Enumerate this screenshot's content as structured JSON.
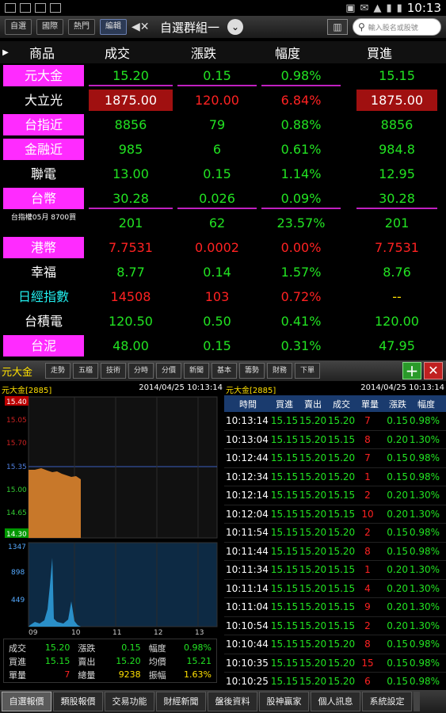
{
  "status": {
    "time": "10:13"
  },
  "toolbar": {
    "buttons": [
      "自選",
      "國際",
      "熱門",
      "編輯"
    ],
    "group_title": "自選群組一",
    "search_placeholder": "輸入股名或股號"
  },
  "quote_headers": [
    "商品",
    "成交",
    "漲跌",
    "幅度",
    "買進"
  ],
  "quotes": [
    {
      "name": "元大金",
      "price": "15.20",
      "change": "0.15",
      "pct": "0.98%",
      "bid": "15.15"
    },
    {
      "name": "大立光",
      "price": "1875.00",
      "change": "120.00",
      "pct": "6.84%",
      "bid": "1875.00"
    },
    {
      "name": "台指近",
      "price": "8856",
      "change": "79",
      "pct": "0.88%",
      "bid": "8856"
    },
    {
      "name": "金融近",
      "price": "985",
      "change": "6",
      "pct": "0.61%",
      "bid": "984.8"
    },
    {
      "name": "聯電",
      "price": "13.00",
      "change": "0.15",
      "pct": "1.14%",
      "bid": "12.95"
    },
    {
      "name": "台幣",
      "price": "30.28",
      "change": "0.026",
      "pct": "0.09%",
      "bid": "30.28"
    },
    {
      "name": "台指權05月 8700買",
      "price": "201",
      "change": "62",
      "pct": "23.57%",
      "bid": "201"
    },
    {
      "name": "港幣",
      "price": "7.7531",
      "change": "0.0002",
      "pct": "0.00%",
      "bid": "7.7531"
    },
    {
      "name": "幸福",
      "price": "8.77",
      "change": "0.14",
      "pct": "1.57%",
      "bid": "8.76"
    },
    {
      "name": "日經指數",
      "price": "14508",
      "change": "103",
      "pct": "0.72%",
      "bid": "--"
    },
    {
      "name": "台積電",
      "price": "120.50",
      "change": "0.50",
      "pct": "0.41%",
      "bid": "120.00"
    },
    {
      "name": "台泥",
      "price": "48.00",
      "change": "0.15",
      "pct": "0.31%",
      "bid": "47.95"
    }
  ],
  "detail": {
    "title": "元大金",
    "tabs": [
      "走勢",
      "五檔",
      "技術",
      "分時",
      "分價",
      "新聞",
      "基本",
      "籌勢",
      "財務",
      "下單"
    ]
  },
  "chart": {
    "stock": "元大金[2885]",
    "datetime": "2014/04/25 10:13:14",
    "price_ticks": [
      "15.40",
      "15.05",
      "15.70",
      "15.35",
      "15.00",
      "14.65",
      "14.30"
    ],
    "volume_ticks": [
      "1347",
      "898",
      "449"
    ],
    "time_ticks": [
      "09",
      "10",
      "11",
      "12",
      "13"
    ]
  },
  "stats": {
    "rows": [
      {
        "l1": "成交",
        "v1": "15.20",
        "l2": "漲跌",
        "v2": "0.15",
        "l3": "幅度",
        "v3": "0.98%"
      },
      {
        "l1": "買進",
        "v1": "15.15",
        "l2": "賣出",
        "v2": "15.20",
        "l3": "均價",
        "v3": "15.21"
      },
      {
        "l1": "單量",
        "v1": "7",
        "l2": "總量",
        "v2": "9238",
        "l3": "振幅",
        "v3": "1.63%"
      }
    ]
  },
  "ticks": {
    "stock": "元大金[2885]",
    "datetime": "2014/04/25 10:13:14",
    "headers": [
      "時間",
      "買進",
      "賣出",
      "成交",
      "單量",
      "漲跌",
      "幅度"
    ],
    "rows": [
      [
        "10:13:14",
        "15.15",
        "15.20",
        "15.20",
        "7",
        "0.15",
        "0.98%"
      ],
      [
        "10:13:04",
        "15.15",
        "15.20",
        "15.15",
        "8",
        "0.20",
        "1.30%"
      ],
      [
        "10:12:44",
        "15.15",
        "15.20",
        "15.20",
        "7",
        "0.15",
        "0.98%"
      ],
      [
        "10:12:34",
        "15.15",
        "15.20",
        "15.20",
        "1",
        "0.15",
        "0.98%"
      ],
      [
        "10:12:14",
        "15.15",
        "15.20",
        "15.15",
        "2",
        "0.20",
        "1.30%"
      ],
      [
        "10:12:04",
        "15.15",
        "15.20",
        "15.15",
        "10",
        "0.20",
        "1.30%"
      ],
      [
        "10:11:54",
        "15.15",
        "15.20",
        "15.20",
        "2",
        "0.15",
        "0.98%"
      ],
      [
        "10:11:44",
        "15.15",
        "15.20",
        "15.20",
        "8",
        "0.15",
        "0.98%"
      ],
      [
        "10:11:34",
        "15.15",
        "15.20",
        "15.15",
        "1",
        "0.20",
        "1.30%"
      ],
      [
        "10:11:14",
        "15.15",
        "15.20",
        "15.15",
        "4",
        "0.20",
        "1.30%"
      ],
      [
        "10:11:04",
        "15.15",
        "15.20",
        "15.15",
        "9",
        "0.20",
        "1.30%"
      ],
      [
        "10:10:54",
        "15.15",
        "15.20",
        "15.15",
        "2",
        "0.20",
        "1.30%"
      ],
      [
        "10:10:44",
        "15.15",
        "15.20",
        "15.20",
        "8",
        "0.15",
        "0.98%"
      ],
      [
        "10:10:35",
        "15.15",
        "15.20",
        "15.20",
        "15",
        "0.15",
        "0.98%"
      ],
      [
        "10:10:25",
        "15.15",
        "15.20",
        "15.20",
        "6",
        "0.15",
        "0.98%"
      ]
    ]
  },
  "bottom_nav": [
    "自選報價",
    "類股報價",
    "交易功能",
    "財經新聞",
    "盤後資料",
    "股神贏家",
    "個人訊息",
    "系統設定"
  ]
}
